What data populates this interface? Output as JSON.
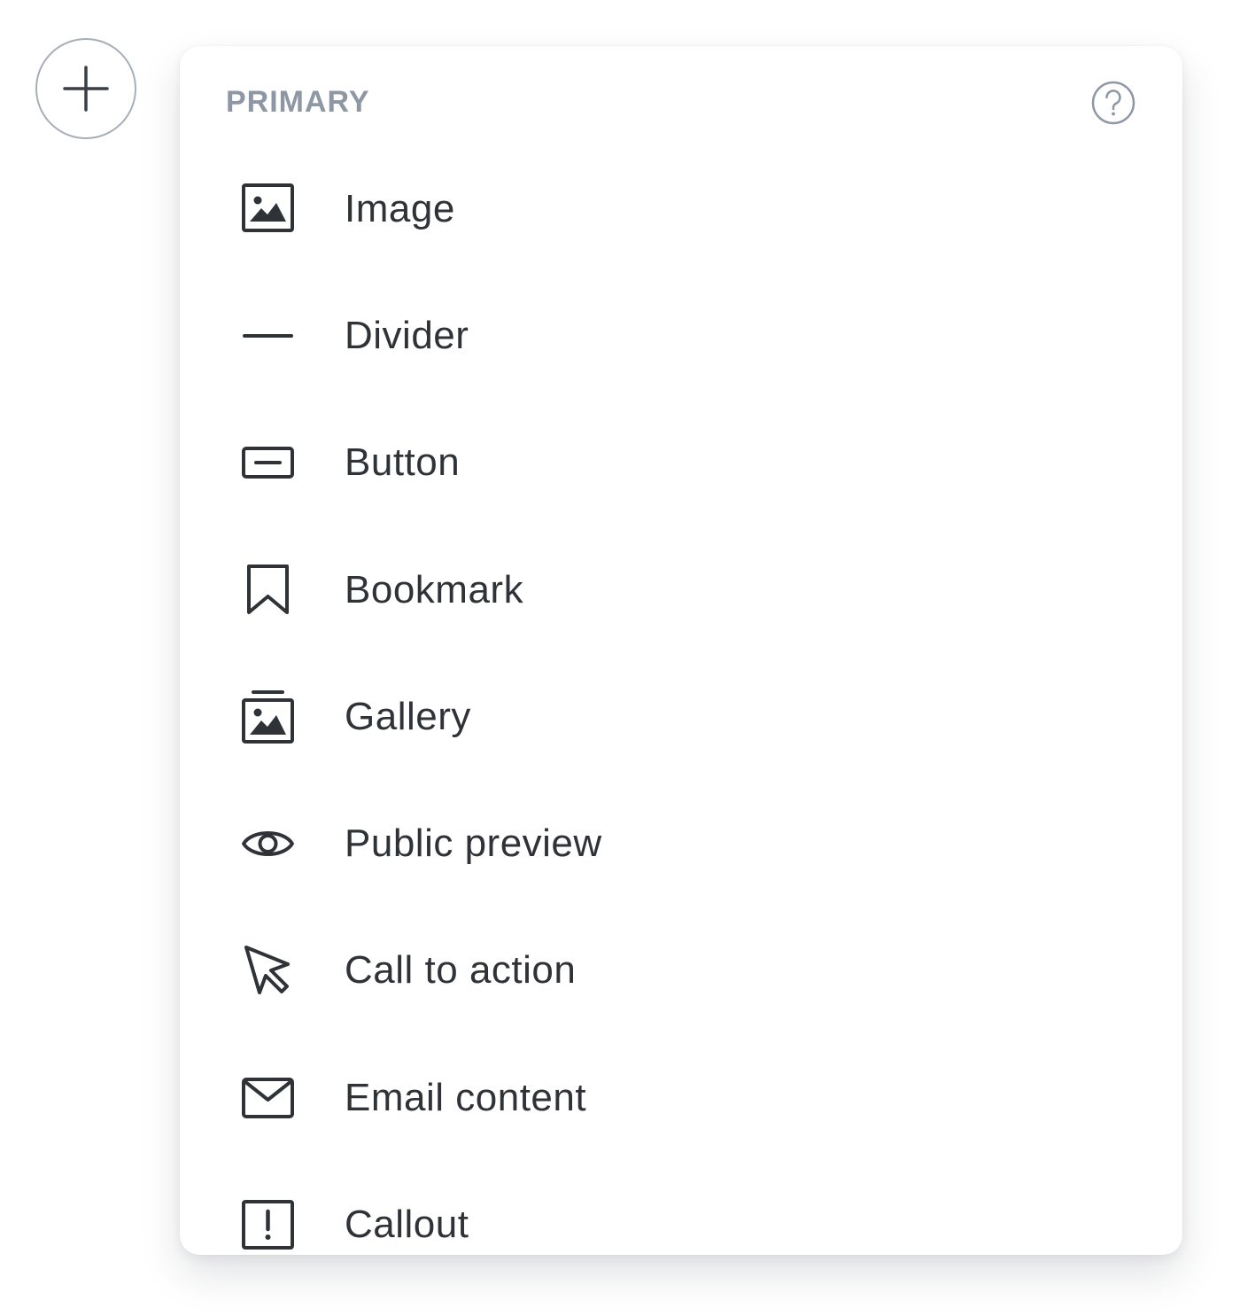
{
  "section": {
    "title": "PRIMARY",
    "help_icon": "question-circle-icon"
  },
  "add_button": {
    "icon": "plus-icon"
  },
  "menu": {
    "items": [
      {
        "label": "Image",
        "icon": "image-icon"
      },
      {
        "label": "Divider",
        "icon": "divider-icon"
      },
      {
        "label": "Button",
        "icon": "button-icon"
      },
      {
        "label": "Bookmark",
        "icon": "bookmark-icon"
      },
      {
        "label": "Gallery",
        "icon": "gallery-icon"
      },
      {
        "label": "Public preview",
        "icon": "eye-icon"
      },
      {
        "label": "Call to action",
        "icon": "cursor-icon"
      },
      {
        "label": "Email content",
        "icon": "envelope-icon"
      },
      {
        "label": "Callout",
        "icon": "callout-icon"
      }
    ]
  },
  "colors": {
    "icon": "#2f3338",
    "label": "#2f3338",
    "header": "#8e97a4",
    "border": "#a7aeb8"
  }
}
